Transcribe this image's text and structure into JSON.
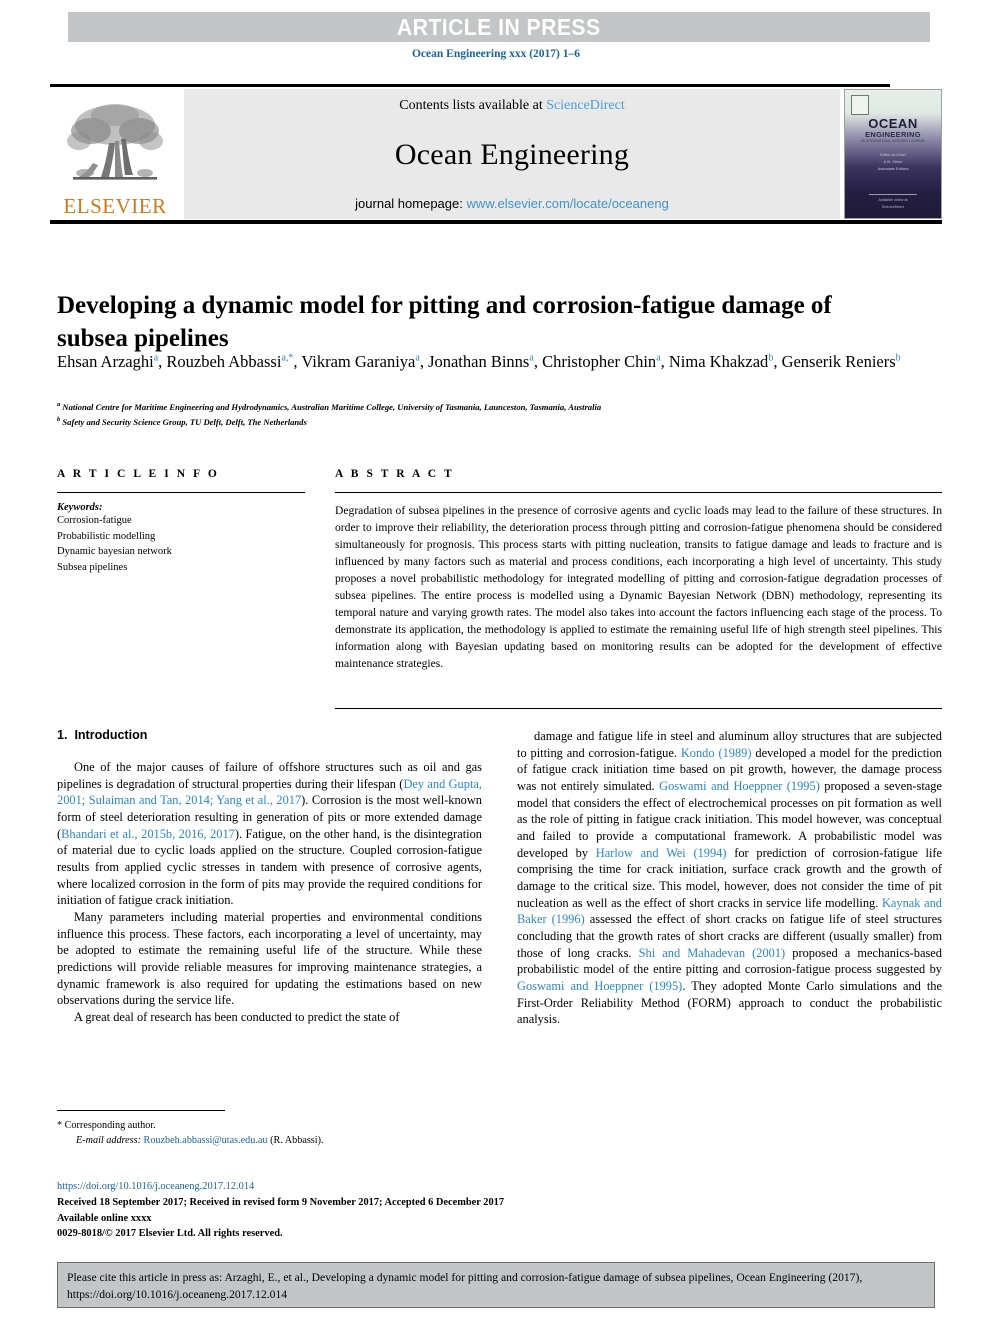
{
  "banner": {
    "text": "ARTICLE IN PRESS",
    "bg_color": "#c3c5c7",
    "text_color": "#ffffff"
  },
  "journal_ref": "Ocean Engineering xxx (2017) 1–6",
  "masthead": {
    "publisher_wordmark": "ELSEVIER",
    "publisher_color": "#d07a1a",
    "contents_prefix": "Contents lists available at ",
    "contents_link": "ScienceDirect",
    "journal_name": "Ocean Engineering",
    "homepage_prefix": "journal homepage: ",
    "homepage_link": "www.elsevier.com/locate/oceaneng",
    "link_color": "#3f93c8",
    "cover": {
      "title": "OCEAN",
      "subtitle": "ENGINEERING",
      "tagline": "AN INTERNATIONAL RESEARCH JOURNAL",
      "editors": [
        "Editor-in-Chief",
        "A.N. Other",
        "Associate Editors"
      ],
      "footer": [
        "Available online at",
        "ScienceDirect"
      ]
    }
  },
  "article": {
    "title": "Developing a dynamic model for pitting and corrosion-fatigue damage of subsea pipelines",
    "authors": [
      {
        "name": "Ehsan Arzaghi",
        "sup": "a"
      },
      {
        "name": "Rouzbeh Abbassi",
        "sup": "a,*"
      },
      {
        "name": "Vikram Garaniya",
        "sup": "a"
      },
      {
        "name": "Jonathan Binns",
        "sup": "a"
      },
      {
        "name": "Christopher Chin",
        "sup": "a"
      },
      {
        "name": "Nima Khakzad",
        "sup": "b"
      },
      {
        "name": "Genserik Reniers",
        "sup": "b"
      }
    ],
    "affiliations": [
      {
        "marker": "a",
        "text": "National Centre for Maritime Engineering and Hydrodynamics, Australian Maritime College, University of Tasmania, Launceston, Tasmania, Australia"
      },
      {
        "marker": "b",
        "text": "Safety and Security Science Group, TU Delft, Delft, The Netherlands"
      }
    ]
  },
  "article_info": {
    "heading": "A R T I C L E   I N F O",
    "keywords_label": "Keywords:",
    "keywords": [
      "Corrosion-fatigue",
      "Probabilistic modelling",
      "Dynamic bayesian network",
      "Subsea pipelines"
    ]
  },
  "abstract": {
    "heading": "A B S T R A C T",
    "text": "Degradation of subsea pipelines in the presence of corrosive agents and cyclic loads may lead to the failure of these structures. In order to improve their reliability, the deterioration process through pitting and corrosion-fatigue phenomena should be considered simultaneously for prognosis. This process starts with pitting nucleation, transits to fatigue damage and leads to fracture and is influenced by many factors such as material and process conditions, each incorporating a high level of uncertainty. This study proposes a novel probabilistic methodology for integrated modelling of pitting and corrosion-fatigue degradation processes of subsea pipelines. The entire process is modelled using a Dynamic Bayesian Network (DBN) methodology, representing its temporal nature and varying growth rates. The model also takes into account the factors influencing each stage of the process. To demonstrate its application, the methodology is applied to estimate the remaining useful life of high strength steel pipelines. This information along with Bayesian updating based on monitoring results can be adopted for the development of effective maintenance strategies."
  },
  "introduction": {
    "number": "1.",
    "heading": "Introduction",
    "left_paragraphs": [
      {
        "segments": [
          {
            "t": "One of the major causes of failure of offshore structures such as oil and gas pipelines is degradation of structural properties during their lifespan (",
            "link": false
          },
          {
            "t": "Dey and Gupta, 2001; Sulaiman and Tan, 2014; Yang et al., 2017",
            "link": true
          },
          {
            "t": "). Corrosion is the most well-known form of steel deterioration resulting in generation of pits or more extended damage (",
            "link": false
          },
          {
            "t": "Bhandari et al., 2015b, 2016, 2017",
            "link": true
          },
          {
            "t": "). Fatigue, on the other hand, is the disintegration of material due to cyclic loads applied on the structure. Coupled corrosion-fatigue results from applied cyclic stresses in tandem with presence of corrosive agents, where localized corrosion in the form of pits may provide the required conditions for initiation of fatigue crack initiation.",
            "link": false
          }
        ]
      },
      {
        "segments": [
          {
            "t": "Many parameters including material properties and environmental conditions influence this process. These factors, each incorporating a level of uncertainty, may be adopted to estimate the remaining useful life of the structure. While these predictions will provide reliable measures for improving maintenance strategies, a dynamic framework is also required for updating the estimations based on new observations during the service life.",
            "link": false
          }
        ]
      },
      {
        "segments": [
          {
            "t": "A great deal of research has been conducted to predict the state of",
            "link": false
          }
        ]
      }
    ],
    "right_paragraphs": [
      {
        "segments": [
          {
            "t": "damage and fatigue life in steel and aluminum alloy structures that are subjected to pitting and corrosion-fatigue. ",
            "link": false
          },
          {
            "t": "Kondo (1989)",
            "link": true
          },
          {
            "t": " developed a model for the prediction of fatigue crack initiation time based on pit growth, however, the damage process was not entirely simulated. ",
            "link": false
          },
          {
            "t": "Goswami and Hoeppner (1995)",
            "link": true
          },
          {
            "t": " proposed a seven-stage model that considers the effect of electrochemical processes on pit formation as well as the role of pitting in fatigue crack initiation. This model however, was conceptual and failed to provide a computational framework. A probabilistic model was developed by ",
            "link": false
          },
          {
            "t": "Harlow and Wei (1994)",
            "link": true
          },
          {
            "t": " for prediction of corrosion-fatigue life comprising the time for crack initiation, surface crack growth and the growth of damage to the critical size. This model, however, does not consider the time of pit nucleation as well as the effect of short cracks in service life modelling. ",
            "link": false
          },
          {
            "t": "Kaynak and Baker (1996)",
            "link": true
          },
          {
            "t": " assessed the effect of short cracks on fatigue life of steel structures concluding that the growth rates of short cracks are different (usually smaller) from those of long cracks. ",
            "link": false
          },
          {
            "t": "Shi and Mahadevan (2001)",
            "link": true
          },
          {
            "t": " proposed a mechanics-based probabilistic model of the entire pitting and corrosion-fatigue process suggested by ",
            "link": false
          },
          {
            "t": "Goswami and Hoeppner (1995)",
            "link": true
          },
          {
            "t": ". They adopted Monte Carlo simulations and the First-Order Reliability Method (FORM) approach to conduct the probabilistic analysis.",
            "link": false
          }
        ]
      }
    ]
  },
  "footnotes": {
    "corresponding": "* Corresponding author.",
    "email_label": "E-mail address:",
    "email": "Rouzbeh.abbassi@utas.edu.au",
    "email_suffix": " (R. Abbassi)."
  },
  "publication": {
    "doi": "https://doi.org/10.1016/j.oceaneng.2017.12.014",
    "history": "Received 18 September 2017; Received in revised form 9 November 2017; Accepted 6 December 2017",
    "available": "Available online xxxx",
    "copyright": "0029-8018/© 2017 Elsevier Ltd. All rights reserved."
  },
  "citation_box": {
    "text": "Please cite this article in press as: Arzaghi, E., et al., Developing a dynamic model for pitting and corrosion-fatigue damage of subsea pipelines, Ocean Engineering (2017), https://doi.org/10.1016/j.oceaneng.2017.12.014"
  },
  "colors": {
    "link_blue": "#2b87c4",
    "ref_blue": "#1a6496",
    "banner_gray": "#c3c5c7",
    "masthead_gray": "#e9e9e9",
    "elsevier_orange": "#d07a1a"
  }
}
